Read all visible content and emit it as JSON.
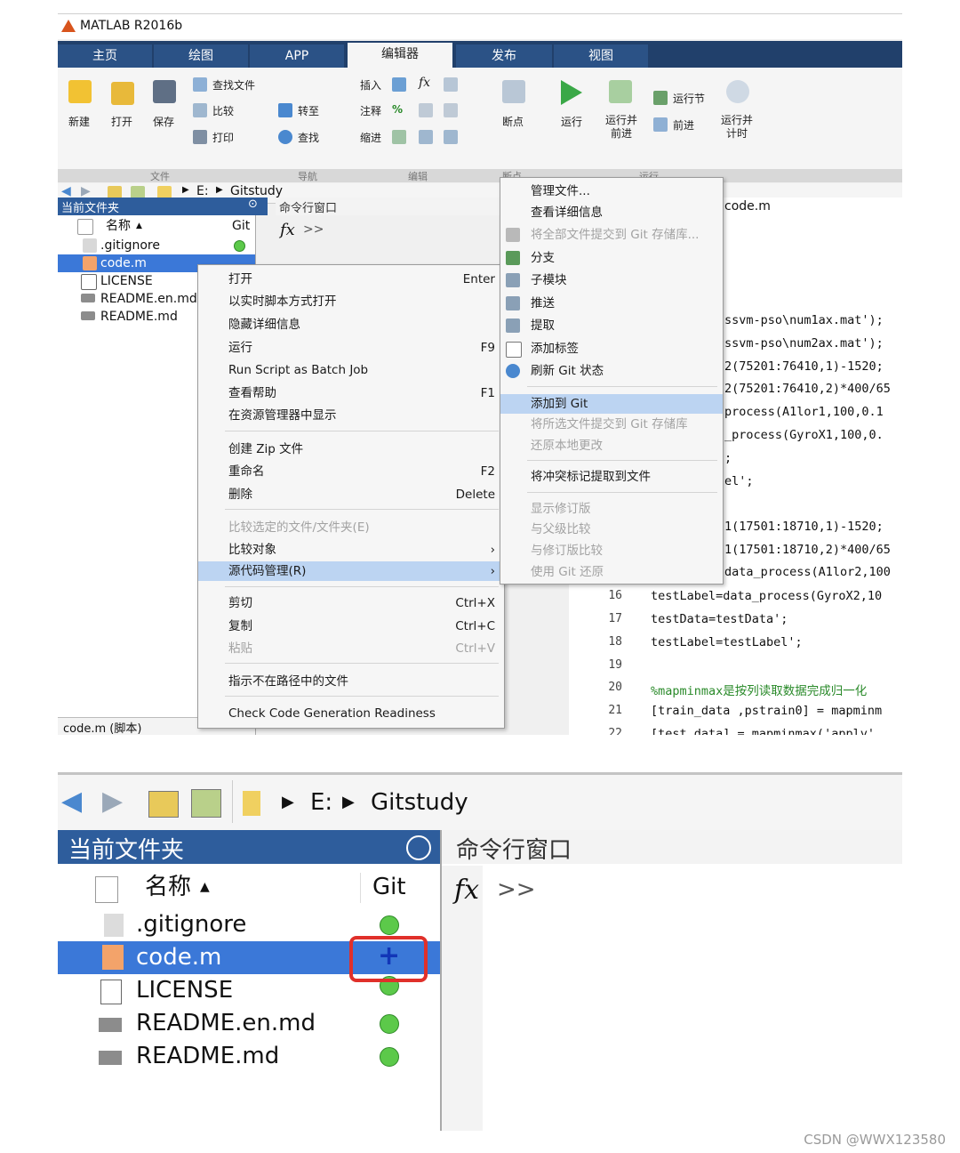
{
  "app_title": "MATLAB R2016b",
  "tabs": [
    {
      "label": "主页"
    },
    {
      "label": "绘图"
    },
    {
      "label": "APP"
    },
    {
      "label": "编辑器"
    },
    {
      "label": "发布"
    },
    {
      "label": "视图"
    }
  ],
  "ribbon": {
    "new_label": "新建",
    "open_label": "打开",
    "save_label": "保存",
    "find_files_label": "查找文件",
    "compare_label": "比较",
    "print_label": "打印",
    "goto_label": "转至",
    "find_label": "查找",
    "insert_label": "插入",
    "comment_label": "注释",
    "indent_label": "缩进",
    "breakpoint_label": "断点",
    "run_label": "运行",
    "run_advance_label": "运行并\n前进",
    "run_section_label": "运行节",
    "advance_label": "前进",
    "run_time_label": "运行并\n计时",
    "group_file": "文件",
    "group_nav": "导航",
    "group_edit": "编辑",
    "group_breakpoint": "断点",
    "group_run": "运行"
  },
  "path": {
    "drive": "E:",
    "folder": "Gitstudy"
  },
  "folder_panel": {
    "title": "当前文件夹",
    "col_name": "名称",
    "col_git": "Git",
    "files": [
      {
        "name": ".gitignore"
      },
      {
        "name": "code.m"
      },
      {
        "name": "LICENSE"
      },
      {
        "name": "README.en.md"
      },
      {
        "name": "README.md"
      }
    ],
    "status": "code.m (脚本)"
  },
  "command_window": {
    "title": "命令行窗口",
    "prompt": ">>"
  },
  "editor": {
    "tab": "code.m",
    "fragments": [
      "ssvm-pso\\num1ax.mat');",
      "ssvm-pso\\num2ax.mat');",
      "2(75201:76410,1)-1520;",
      "2(75201:76410,2)*400/65",
      "process(A1lor1,100,0.1",
      "_process(GyroX1,100,0.",
      ";",
      "el';",
      "1(17501:18710,1)-1520;",
      "1(17501:18710,2)*400/65",
      "data_process(A1lor2,100"
    ],
    "lines": [
      {
        "num": "16",
        "code": "testLabel=data_process(GyroX2,10"
      },
      {
        "num": "17",
        "code": "testData=testData';"
      },
      {
        "num": "18",
        "code": "testLabel=testLabel';"
      },
      {
        "num": "19",
        "code": ""
      },
      {
        "num": "20",
        "code": "%mapminmax是按列读取数据完成归一化"
      },
      {
        "num": "21",
        "code": "[train_data ,pstrain0] = mapminm"
      },
      {
        "num": "22",
        "code": "[test_data] = mapminmax('apply',"
      }
    ]
  },
  "context_menu": [
    {
      "label": "打开",
      "shortcut": "Enter"
    },
    {
      "label": "以实时脚本方式打开",
      "shortcut": ""
    },
    {
      "label": "隐藏详细信息",
      "shortcut": ""
    },
    {
      "label": "运行",
      "shortcut": "F9"
    },
    {
      "label": "Run Script as Batch Job",
      "shortcut": ""
    },
    {
      "label": "查看帮助",
      "shortcut": "F1"
    },
    {
      "label": "在资源管理器中显示",
      "shortcut": ""
    },
    {
      "label": "创建 Zip 文件",
      "shortcut": ""
    },
    {
      "label": "重命名",
      "shortcut": "F2"
    },
    {
      "label": "删除",
      "shortcut": "Delete"
    },
    {
      "label": "比较选定的文件/文件夹(E)",
      "shortcut": ""
    },
    {
      "label": "比较对象",
      "shortcut": "›"
    },
    {
      "label": "源代码管理(R)",
      "shortcut": "›"
    },
    {
      "label": "剪切",
      "shortcut": "Ctrl+X"
    },
    {
      "label": "复制",
      "shortcut": "Ctrl+C"
    },
    {
      "label": "粘贴",
      "shortcut": "Ctrl+V"
    },
    {
      "label": "指示不在路径中的文件",
      "shortcut": ""
    },
    {
      "label": "Check Code Generation Readiness",
      "shortcut": ""
    }
  ],
  "submenu": [
    {
      "label": "管理文件..."
    },
    {
      "label": "查看详细信息"
    },
    {
      "label": "将全部文件提交到 Git 存储库..."
    },
    {
      "label": "分支"
    },
    {
      "label": "子模块"
    },
    {
      "label": "推送"
    },
    {
      "label": "提取"
    },
    {
      "label": "添加标签"
    },
    {
      "label": "刷新 Git 状态"
    },
    {
      "label": "添加到 Git"
    },
    {
      "label": "将所选文件提交到 Git 存储库"
    },
    {
      "label": "还原本地更改"
    },
    {
      "label": "将冲突标记提取到文件"
    },
    {
      "label": "显示修订版"
    },
    {
      "label": "与父级比较"
    },
    {
      "label": "与修订版比较"
    },
    {
      "label": "使用 Git 还原"
    }
  ],
  "bottom": {
    "path": {
      "drive": "E:",
      "folder": "Gitstudy"
    },
    "folder_title": "当前文件夹",
    "col_name": "名称",
    "col_git": "Git",
    "files": [
      {
        "name": ".gitignore"
      },
      {
        "name": "code.m"
      },
      {
        "name": "LICENSE"
      },
      {
        "name": "README.en.md"
      },
      {
        "name": "README.md"
      }
    ],
    "added_symbol": "+",
    "command_title": "命令行窗口",
    "prompt": ">>"
  },
  "watermark": "CSDN @WWX123580",
  "colors": {
    "accent": "#3b78d8",
    "tabbar": "#21406b",
    "git_ok": "#5cc94a",
    "highlight_box": "#e0302a"
  }
}
